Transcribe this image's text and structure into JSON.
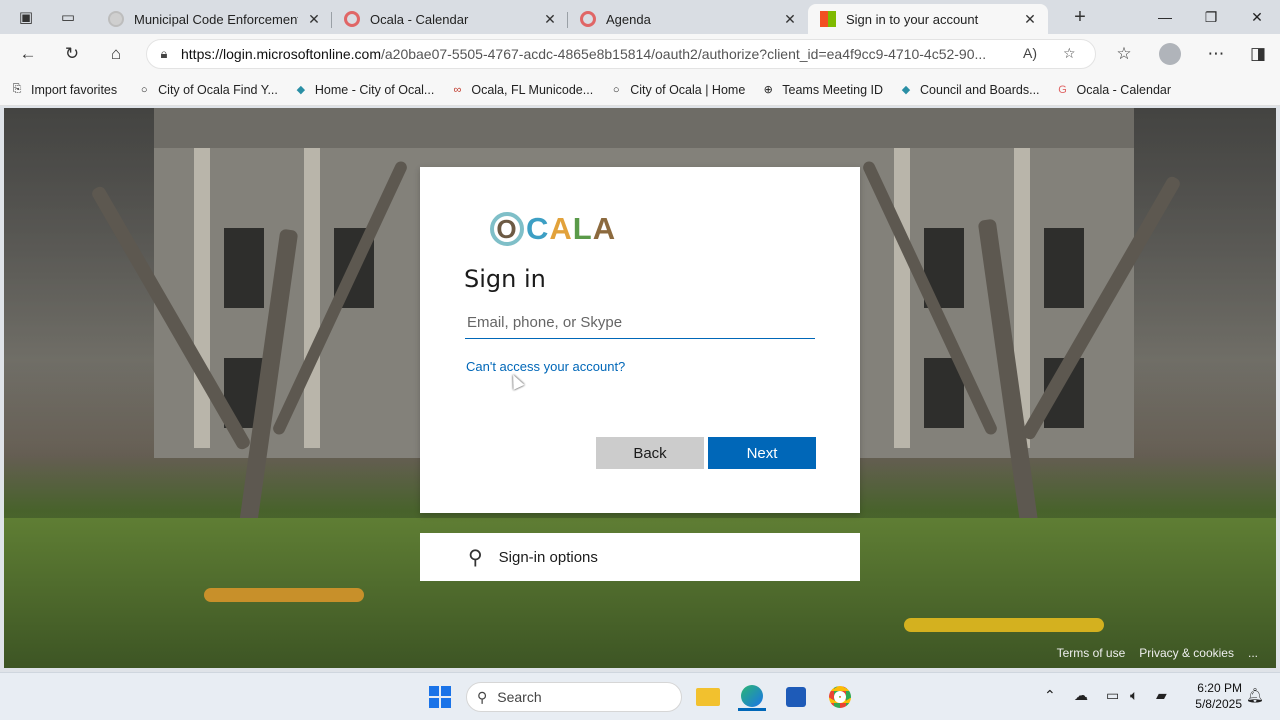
{
  "browser": {
    "tabs": [
      {
        "title": "Municipal Code Enforcement Boa",
        "favicon_color": "#bdbdbd"
      },
      {
        "title": "Ocala - Calendar",
        "favicon_color": "#e06666"
      },
      {
        "title": "Agenda",
        "favicon_color": "#e06666"
      },
      {
        "title": "Sign in to your account",
        "favicon_color": "#0078d4"
      }
    ],
    "new_tab_label": "+",
    "address_url_host": "https://login.microsoftonline.com",
    "address_url_path": "/a20bae07-5505-4767-acdc-4865e8b15814/oauth2/authorize?client_id=ea4f9cc9-4710-4c52-90..."
  },
  "favorites": [
    {
      "label": "Import favorites",
      "icon": "import-icon"
    },
    {
      "label": "City of Ocala  Find Y...",
      "icon": "globe-circle-icon"
    },
    {
      "label": "Home - City of Ocal...",
      "icon": "diamond-icon"
    },
    {
      "label": "Ocala, FL  Municode...",
      "icon": "municode-icon"
    },
    {
      "label": "City of Ocala | Home",
      "icon": "globe-circle-icon"
    },
    {
      "label": "Teams Meeting ID",
      "icon": "globe-icon"
    },
    {
      "label": "Council and Boards...",
      "icon": "diamond-icon"
    },
    {
      "label": "Ocala - Calendar",
      "icon": "google-icon"
    }
  ],
  "signin": {
    "logo_text": "CALA",
    "logo_o": "O",
    "heading": "Sign in",
    "email_placeholder": "Email, phone, or Skype",
    "cant_access": "Can't access your account?",
    "back_label": "Back",
    "next_label": "Next",
    "options_label": "Sign-in options"
  },
  "footer": {
    "terms": "Terms of use",
    "privacy": "Privacy & cookies",
    "more": "..."
  },
  "taskbar": {
    "search_label": "Search",
    "time": "6:20 PM",
    "date": "5/8/2025"
  },
  "colors": {
    "accent": "#0067b8",
    "back_button": "#cccccc"
  }
}
